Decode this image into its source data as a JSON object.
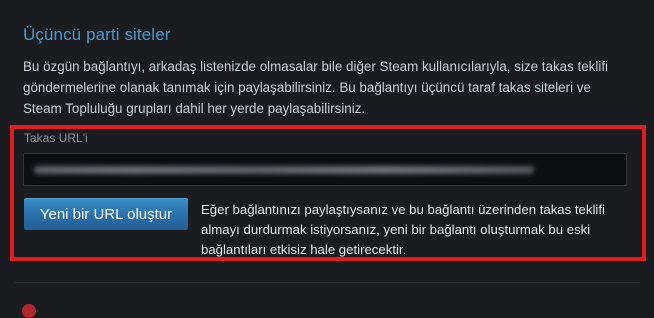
{
  "section": {
    "title": "Üçüncü parti siteler",
    "description": "Bu özgün bağlantıyı, arkadaş listenizde olmasalar bile diğer Steam kullanıcılarıyla, size takas teklifi göndermelerine olanak tanımak için paylaşabilirsiniz. Bu bağlantıyı üçüncü taraf takas siteleri ve Steam Topluluğu grupları dahil her yerde paylaşabilirsiniz."
  },
  "trade_url": {
    "label": "Takas URL'i",
    "value_state": "blurred"
  },
  "actions": {
    "generate_label": "Yeni bir URL oluştur",
    "note": "Eğer bağlantınızı paylaştıysanız ve bu bağlantı üzerinden takas teklifi almayı durdurmak istiyorsanız, yeni bir bağlantı oluşturmak bu eski bağlantıları etkisiz hale getirecektir."
  },
  "colors": {
    "background": "#1b1c20",
    "title": "#4b97c9",
    "button": "#2a6fa8",
    "highlight": "#e01c1c"
  }
}
